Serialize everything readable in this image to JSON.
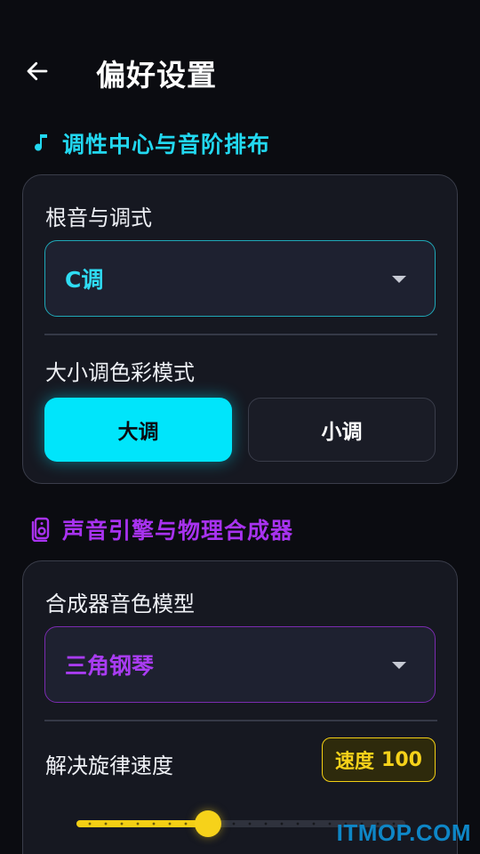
{
  "header": {
    "title": "偏好设置",
    "back_icon": "arrow-left-icon"
  },
  "colors": {
    "accent_cyan": "#00e5fb",
    "accent_purple": "#a93cf2",
    "accent_yellow": "#f3cf14",
    "background": "#0b0c11",
    "card": "#161821"
  },
  "section_key": {
    "icon": "music-note-icon",
    "title": "调性中心与音阶排布",
    "root_label": "根音与调式",
    "root_value": "C调",
    "mode_label": "大小调色彩模式",
    "mode_major": "大调",
    "mode_minor": "小调",
    "mode_selected": "大调"
  },
  "section_sound": {
    "icon": "speaker-icon",
    "title": "声音引擎与物理合成器",
    "timbre_label": "合成器音色模型",
    "timbre_value": "三角钢琴",
    "tempo_label": "解决旋律速度",
    "tempo_badge_label": "速度",
    "tempo_value": "100",
    "tempo_fraction": 0.4
  },
  "watermark": "ITMOP.COM"
}
